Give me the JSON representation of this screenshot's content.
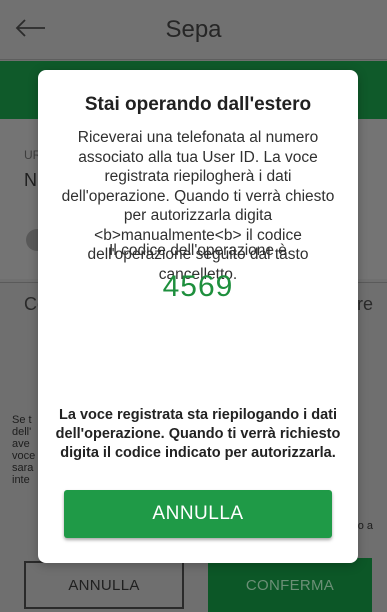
{
  "header": {
    "title": "Sepa",
    "back_icon": "arrow-left-icon"
  },
  "background": {
    "label_ur": "UR",
    "label_n": "N",
    "label_co": "Co",
    "label_re": "re",
    "para_left": "Se t dell' ave voce sara inte",
    "para_right": "no a",
    "cancel_label": "ANNULLA",
    "confirm_label": "CONFERMA"
  },
  "dialog": {
    "title": "Stai operando dall'estero",
    "body": "Riceverai una telefonata al numero associato alla tua User ID. La voce registrata riepilogherà i dati dell'operazione. Quando ti verrà chiesto per autorizzarla digita <b>manualmente<b> il codice dell'operazione seguito dal tasto cancelletto.",
    "code_label": "Il codice dell'operazione è",
    "code_value": "4569",
    "note": "La voce registrata sta riepilogando i dati dell'operazione. Quando ti verrà richiesto digita il codice indicato per autorizzarla.",
    "button_label": "ANNULLA"
  },
  "colors": {
    "accent_green": "#1f9a47",
    "code_green": "#1e8f3d",
    "dark_green": "#0f5a2a"
  }
}
